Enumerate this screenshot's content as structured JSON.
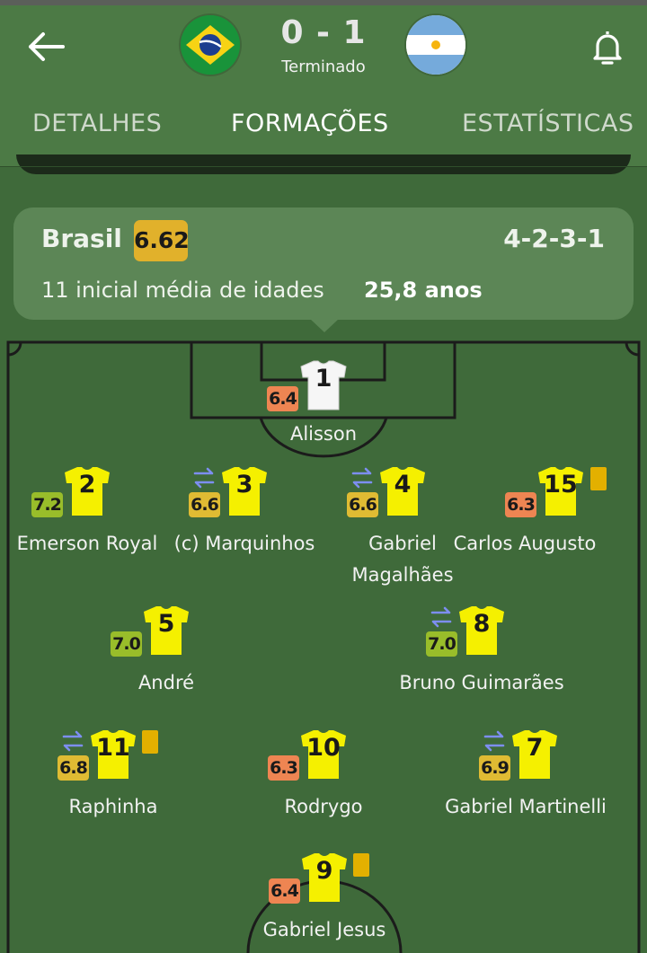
{
  "header": {
    "score": "0 - 1",
    "status": "Terminado",
    "home_flag": "brazil-flag",
    "away_flag": "argentina-flag"
  },
  "tabs": [
    {
      "label": "DETALHES",
      "active": false
    },
    {
      "label": "FORMAÇÕES",
      "active": true
    },
    {
      "label": "ESTATÍSTICAS",
      "active": false
    }
  ],
  "team": {
    "name": "Brasil",
    "rating": "6.62",
    "formation": "4-2-3-1",
    "age_label": "11 inicial média de idades",
    "age_value": "25,8 anos"
  },
  "players": [
    {
      "number": "1",
      "name": "Alisson",
      "rating": "6.4",
      "rating_color": "orange",
      "subbed": false,
      "yellow_card": false,
      "keeper": true
    },
    {
      "number": "2",
      "name": "Emerson Royal",
      "rating": "7.2",
      "rating_color": "green",
      "subbed": false,
      "yellow_card": false
    },
    {
      "number": "3",
      "name": "(c) Marquinhos",
      "rating": "6.6",
      "rating_color": "yellow",
      "subbed": true,
      "yellow_card": false
    },
    {
      "number": "4",
      "name": "Gabriel Magalhães",
      "rating": "6.6",
      "rating_color": "yellow",
      "subbed": true,
      "yellow_card": false
    },
    {
      "number": "15",
      "name": "Carlos Augusto",
      "rating": "6.3",
      "rating_color": "orange",
      "subbed": false,
      "yellow_card": true
    },
    {
      "number": "5",
      "name": "André",
      "rating": "7.0",
      "rating_color": "green",
      "subbed": false,
      "yellow_card": false
    },
    {
      "number": "8",
      "name": "Bruno Guimarães",
      "rating": "7.0",
      "rating_color": "green",
      "subbed": true,
      "yellow_card": false
    },
    {
      "number": "11",
      "name": "Raphinha",
      "rating": "6.8",
      "rating_color": "yellow",
      "subbed": true,
      "yellow_card": true
    },
    {
      "number": "10",
      "name": "Rodrygo",
      "rating": "6.3",
      "rating_color": "orange",
      "subbed": false,
      "yellow_card": false
    },
    {
      "number": "7",
      "name": "Gabriel Martinelli",
      "rating": "6.9",
      "rating_color": "yellow",
      "subbed": true,
      "yellow_card": false
    },
    {
      "number": "9",
      "name": "Gabriel Jesus",
      "rating": "6.4",
      "rating_color": "orange",
      "subbed": false,
      "yellow_card": true
    }
  ],
  "icons": {
    "back": "arrow-left-icon",
    "bell": "bell-icon",
    "sub": "substitution-icon",
    "card": "yellow-card-icon"
  },
  "colors": {
    "background": "#3f6a3a",
    "header": "#4c7a45",
    "home_shirt": "#f5f000",
    "keeper_shirt": "#ffffff",
    "rating_green": "#99bd2a",
    "rating_yellow": "#e0bb33",
    "rating_orange": "#ee8552",
    "team_rating": "#e1b12b"
  }
}
